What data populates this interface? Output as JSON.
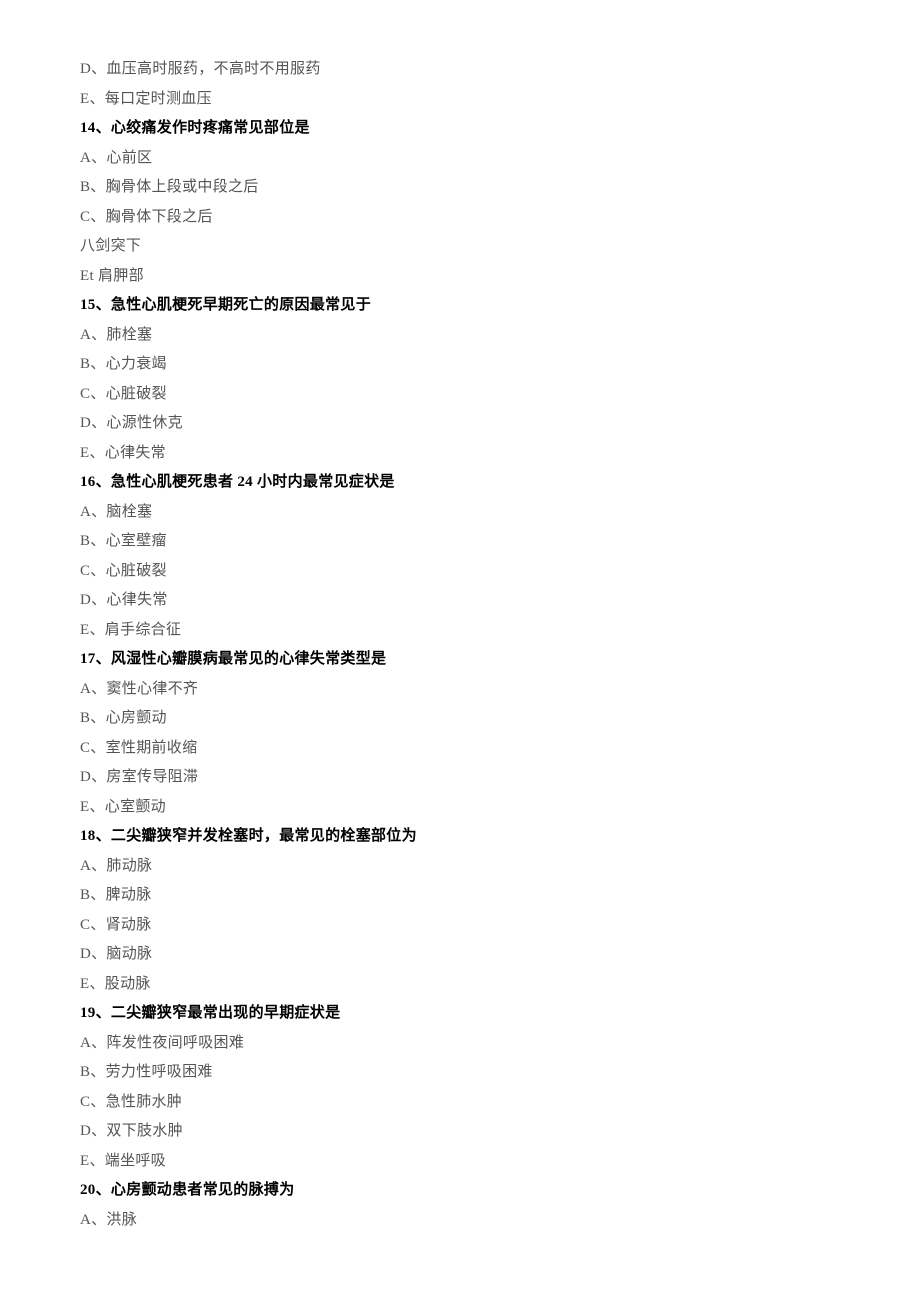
{
  "lines": [
    {
      "text": "D、血压高时服药，不高时不用服药",
      "type": "option"
    },
    {
      "text": "E、每口定时测血压",
      "type": "option"
    },
    {
      "text": "14、心绞痛发作时疼痛常见部位是",
      "type": "question"
    },
    {
      "text": "A、心前区",
      "type": "option"
    },
    {
      "text": "B、胸骨体上段或中段之后",
      "type": "option"
    },
    {
      "text": "C、胸骨体下段之后",
      "type": "option"
    },
    {
      "text": "八剑突下",
      "type": "option"
    },
    {
      "text": "Et 肩胛部",
      "type": "option"
    },
    {
      "text": "15、急性心肌梗死早期死亡的原因最常见于",
      "type": "question"
    },
    {
      "text": "A、肺栓塞",
      "type": "option"
    },
    {
      "text": "B、心力衰竭",
      "type": "option"
    },
    {
      "text": "C、心脏破裂",
      "type": "option"
    },
    {
      "text": "D、心源性休克",
      "type": "option"
    },
    {
      "text": "E、心律失常",
      "type": "option"
    },
    {
      "text": "16、急性心肌梗死患者 24 小时内最常见症状是",
      "type": "question"
    },
    {
      "text": "A、脑栓塞",
      "type": "option"
    },
    {
      "text": "B、心室壁瘤",
      "type": "option"
    },
    {
      "text": "C、心脏破裂",
      "type": "option"
    },
    {
      "text": "D、心律失常",
      "type": "option"
    },
    {
      "text": "E、肩手综合征",
      "type": "option"
    },
    {
      "text": "17、风湿性心瓣膜病最常见的心律失常类型是",
      "type": "question"
    },
    {
      "text": "A、窦性心律不齐",
      "type": "option"
    },
    {
      "text": "B、心房颤动",
      "type": "option"
    },
    {
      "text": "C、室性期前收缩",
      "type": "option"
    },
    {
      "text": "D、房室传导阻滞",
      "type": "option"
    },
    {
      "text": "E、心室颤动",
      "type": "option"
    },
    {
      "text": "18、二尖瓣狭窄并发栓塞时，最常见的栓塞部位为",
      "type": "question"
    },
    {
      "text": "A、肺动脉",
      "type": "option"
    },
    {
      "text": "B、脾动脉",
      "type": "option"
    },
    {
      "text": "C、肾动脉",
      "type": "option"
    },
    {
      "text": "D、脑动脉",
      "type": "option"
    },
    {
      "text": "E、股动脉",
      "type": "option"
    },
    {
      "text": "19、二尖瓣狭窄最常出现的早期症状是",
      "type": "question"
    },
    {
      "text": "A、阵发性夜间呼吸困难",
      "type": "option"
    },
    {
      "text": "B、劳力性呼吸困难",
      "type": "option"
    },
    {
      "text": "C、急性肺水肿",
      "type": "option"
    },
    {
      "text": "D、双下肢水肿",
      "type": "option"
    },
    {
      "text": "E、端坐呼吸",
      "type": "option"
    },
    {
      "text": "20、心房颤动患者常见的脉搏为",
      "type": "question"
    },
    {
      "text": "A、洪脉",
      "type": "option"
    }
  ]
}
